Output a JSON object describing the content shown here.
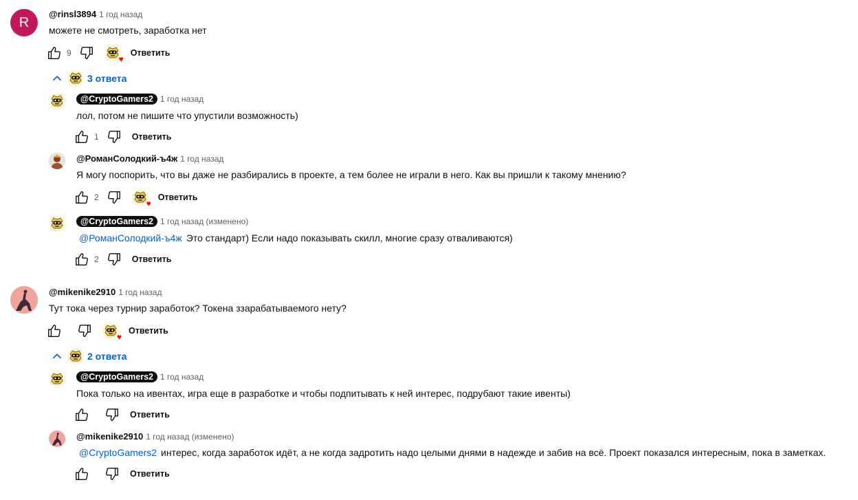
{
  "comments": [
    {
      "avatar_letter": "R",
      "author": "@rinsl3894",
      "time": "1 год назад",
      "text": "можете не смотреть, заработка нет",
      "likes": "9",
      "reply_label": "Ответить",
      "replies_label": "3 ответа",
      "replies": [
        {
          "author": "@CryptoGamers2",
          "time": "1 год назад",
          "text": "лол, потом не пишите что упустили возможность)",
          "likes": "1",
          "reply_label": "Ответить"
        },
        {
          "author": "@РоманСолодкий-ъ4ж",
          "time": "1 год назад",
          "text": "Я могу поспорить, что вы даже не разбирались в проекте, а тем более не играли в него. Как вы пришли к такому мнению?",
          "likes": "2",
          "reply_label": "Ответить"
        },
        {
          "author": "@CryptoGamers2",
          "time": "1 год назад (изменено)",
          "mention": "@РоманСолодкий-ъ4ж",
          "text": "Это стандарт) Если надо показывать скилл, многие сразу отваливаются)",
          "likes": "2",
          "reply_label": "Ответить"
        }
      ]
    },
    {
      "author": "@mikenike2910",
      "time": "1 год назад",
      "text": "Тут тока через турнир заработок? Токена ззарабатываемого нету?",
      "likes": "",
      "reply_label": "Ответить",
      "replies_label": "2 ответа",
      "replies": [
        {
          "author": "@CryptoGamers2",
          "time": "1 год назад",
          "text": "Пока только на ивентах, игра еще в разработке и чтобы подпитывать к ней интерес, подрубают такие ивенты)",
          "likes": "",
          "reply_label": "Ответить"
        },
        {
          "author": "@mikenike2910",
          "time": "1 год назад (изменено)",
          "mention": "@CryptoGamers2",
          "text": "интерес, когда заработок идёт, а не когда задротить надо целыми днями в надежде и забив на всё. Проект показался интересным, пока в заметках.",
          "likes": "",
          "reply_label": "Ответить"
        }
      ]
    }
  ],
  "colors": {
    "link": "#065fd4",
    "heart": "#ff0000",
    "avatar_r": "#c2185b"
  }
}
